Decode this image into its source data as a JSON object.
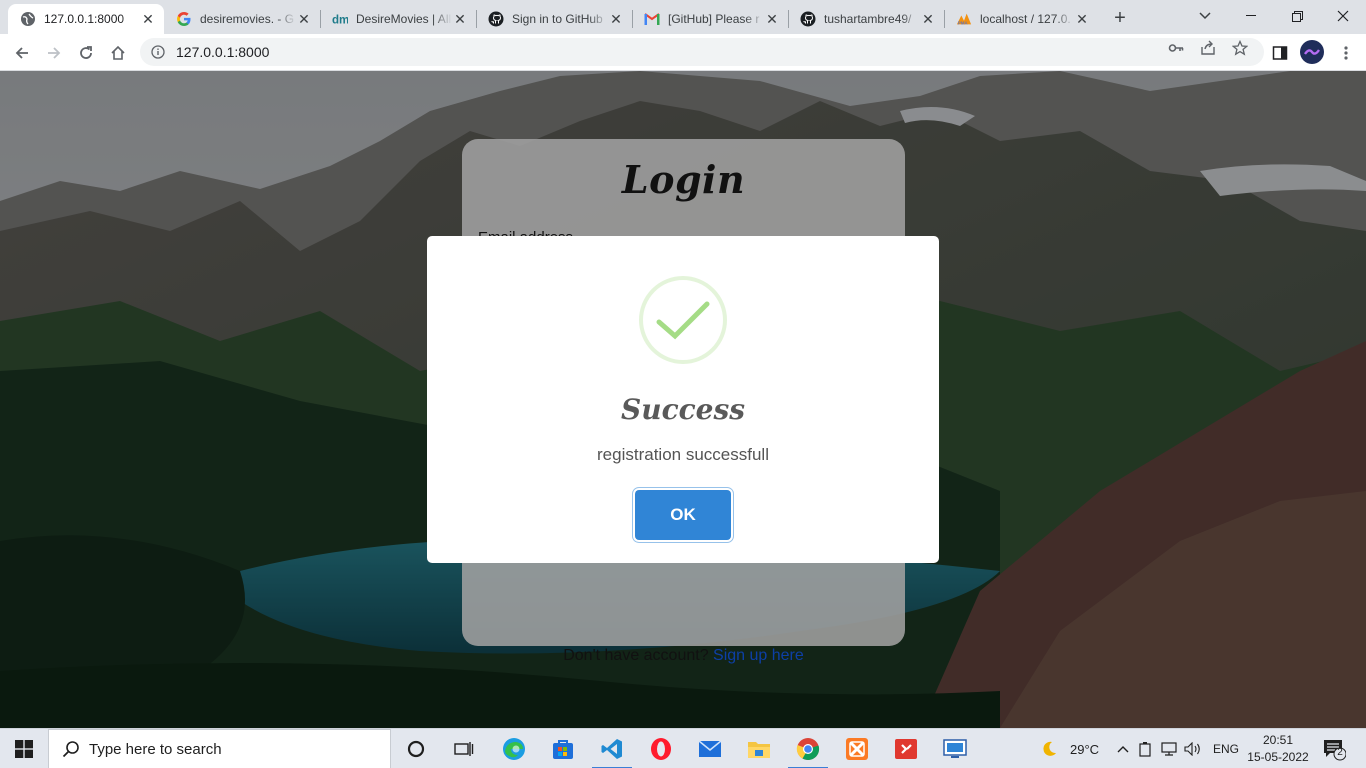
{
  "browser": {
    "tabs": [
      {
        "title": "127.0.0.1:8000",
        "icon": "globe-icon",
        "active": true
      },
      {
        "title": "desiremovies. - G",
        "icon": "google-icon",
        "active": false
      },
      {
        "title": "DesireMovies | All",
        "icon": "desiremovies-icon",
        "active": false
      },
      {
        "title": "Sign in to GitHub",
        "icon": "github-icon",
        "active": false
      },
      {
        "title": "[GitHub] Please r",
        "icon": "gmail-icon",
        "active": false
      },
      {
        "title": "tushartambre49/",
        "icon": "github-icon",
        "active": false
      },
      {
        "title": "localhost / 127.0.",
        "icon": "phpmyadmin-icon",
        "active": false
      }
    ],
    "address": "127.0.0.1:8000"
  },
  "page": {
    "login_title": "Login",
    "email_label": "Email address",
    "signup_prompt": "Don't have account?",
    "signup_link": "Sign up here"
  },
  "modal": {
    "title": "Success",
    "message": "registration successfull",
    "ok_label": "OK",
    "accent_color": "#3085d6",
    "icon_color": "#a5dc86"
  },
  "taskbar": {
    "search_placeholder": "Type here to search",
    "weather": "29°C",
    "language": "ENG",
    "time": "20:51",
    "date": "15-05-2022",
    "notification_count": "2",
    "apps": [
      "task-view-icon",
      "widgets-icon",
      "edge-icon",
      "store-icon",
      "vscode-icon",
      "opera-icon",
      "mail-icon",
      "file-explorer-icon",
      "chrome-icon",
      "xampp-icon",
      "git-icon",
      "remote-desktop-icon"
    ]
  }
}
